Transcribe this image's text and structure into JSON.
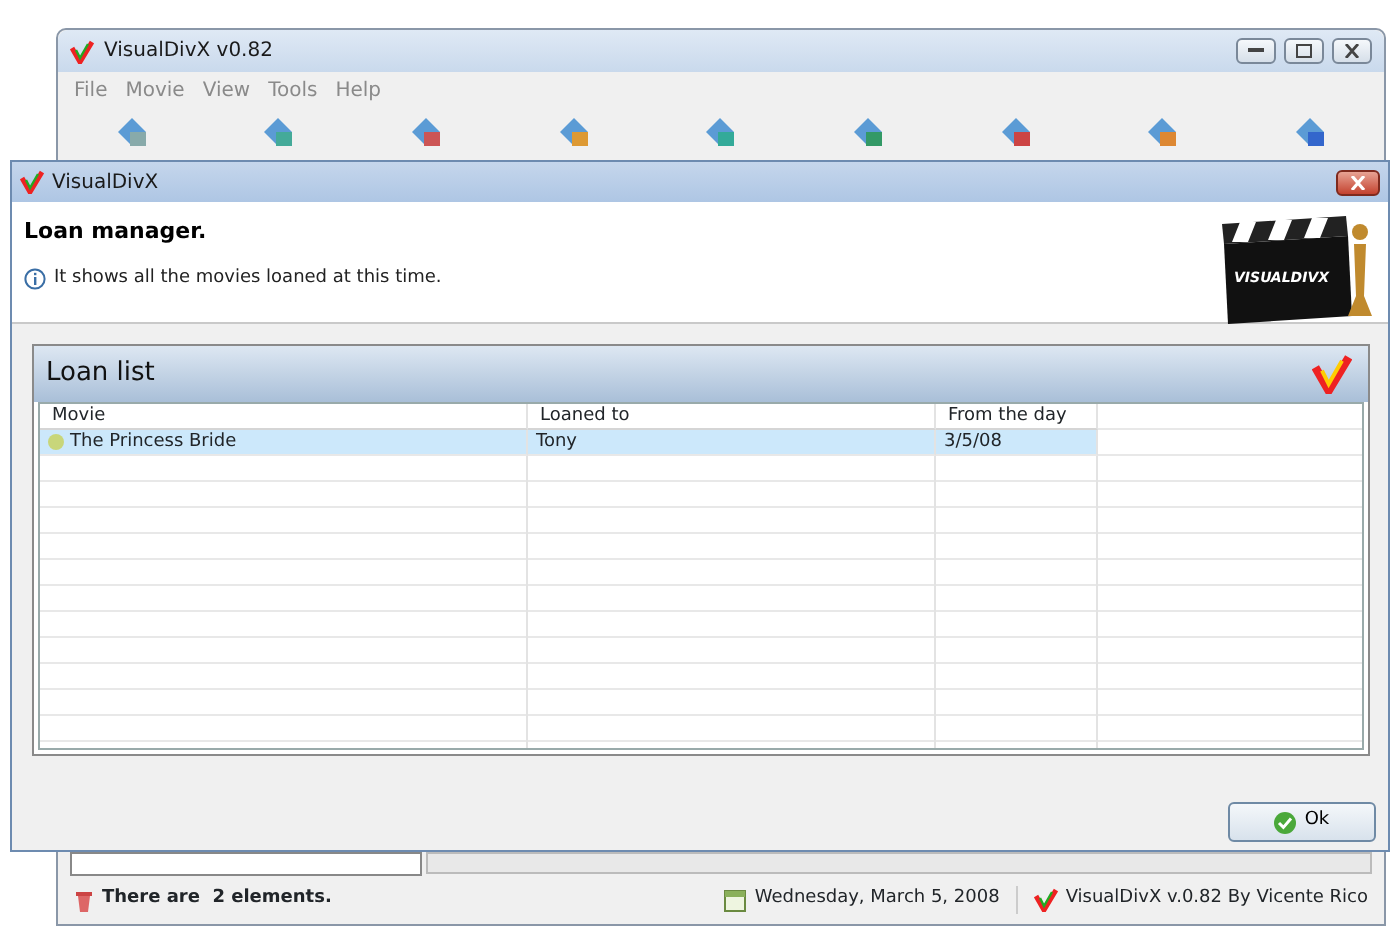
{
  "main_window": {
    "title": "VisualDivX v0.82",
    "menu": [
      "File",
      "Movie",
      "View",
      "Tools",
      "Help"
    ]
  },
  "dialog": {
    "title": "VisualDivX",
    "heading": "Loan manager.",
    "info": "It shows all the movies loaned at this time.",
    "logo_text": "VISUALDIVX",
    "panel": {
      "title": "Loan list",
      "columns": [
        "Movie",
        "Loaned to",
        "From the day"
      ],
      "rows": [
        {
          "movie": "The Princess Bride",
          "loaned_to": "Tony",
          "from_day": "3/5/08",
          "selected": true,
          "color": "#c8d67a"
        }
      ]
    },
    "ok_button": "Ok"
  },
  "status_bar": {
    "count": "There are  2 elements.",
    "date": "Wednesday, March 5, 2008",
    "version": "VisualDivX v.0.82 By Vicente Rico"
  }
}
